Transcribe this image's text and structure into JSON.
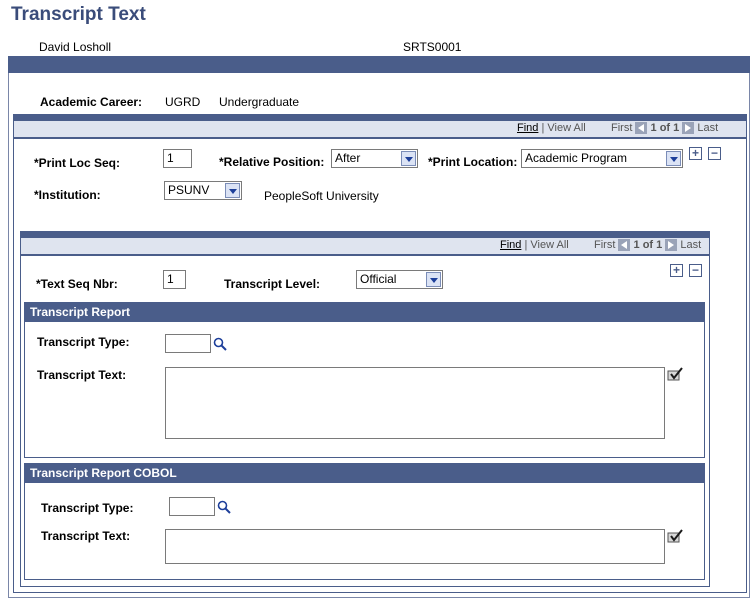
{
  "page": {
    "title": "Transcript Text"
  },
  "header": {
    "name": "David Losholl",
    "id": "SRTS0001"
  },
  "career": {
    "label": "Academic Career:",
    "code": "UGRD",
    "desc": "Undergraduate"
  },
  "outer_nav": {
    "find": "Find",
    "view_all": "View All",
    "first": "First",
    "count": "1 of 1",
    "last": "Last"
  },
  "inner_nav": {
    "find": "Find",
    "view_all": "View All",
    "first": "First",
    "count": "1 of 1",
    "last": "Last"
  },
  "fields": {
    "print_loc_seq_label": "*Print Loc Seq:",
    "print_loc_seq": "1",
    "relative_position_label": "*Relative Position:",
    "relative_position": "After",
    "print_location_label": "*Print Location:",
    "print_location": "Academic Program",
    "institution_label": "*Institution:",
    "institution": "PSUNV",
    "institution_desc": "PeopleSoft University",
    "text_seq_nbr_label": "*Text Seq Nbr:",
    "text_seq_nbr": "1",
    "transcript_level_label": "Transcript Level:",
    "transcript_level": "Official"
  },
  "report": {
    "title": "Transcript Report",
    "type_label": "Transcript Type:",
    "type_value": "",
    "text_label": "Transcript Text:"
  },
  "cobol": {
    "title": "Transcript Report COBOL",
    "type_label": "Transcript Type:",
    "type_value": "",
    "text_label": "Transcript Text:"
  },
  "icons": {
    "add": "+",
    "remove": "−"
  }
}
